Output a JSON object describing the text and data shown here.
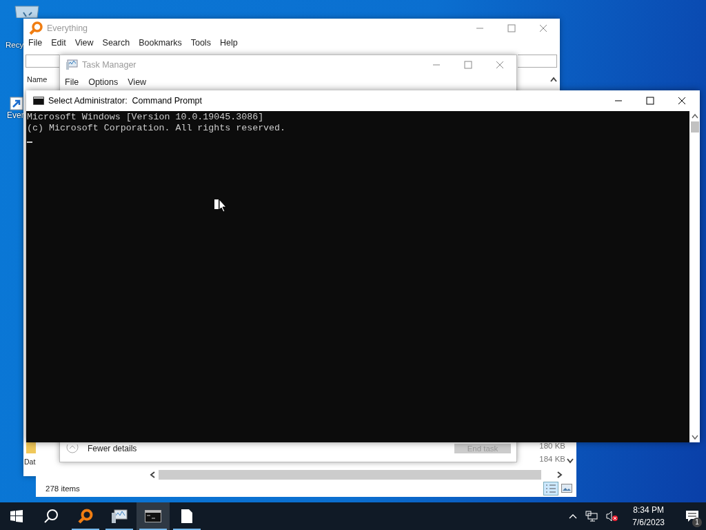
{
  "desktop_icons": [
    {
      "label": "Recy",
      "kind": "recycle"
    },
    {
      "label": "Ever",
      "kind": "shortcut"
    }
  ],
  "everything": {
    "title": "Everything",
    "menu": [
      "File",
      "Edit",
      "View",
      "Search",
      "Bookmarks",
      "Tools",
      "Help"
    ],
    "column": "Name",
    "rows": [
      {
        "name": "Dat",
        "kind": "folder"
      }
    ],
    "sizes": [
      "180 KB",
      "184 KB"
    ],
    "status": "278 items"
  },
  "task_manager": {
    "title": "Task Manager",
    "menu": [
      "File",
      "Options",
      "View"
    ],
    "fewer_details": "Fewer details",
    "end_task": {
      "label": "End task",
      "disabled": true
    }
  },
  "command_prompt": {
    "title": "Select Administrator:  Command Prompt",
    "lines": [
      "Microsoft Windows [Version 10.0.19045.3086]",
      "(c) Microsoft Corporation. All rights reserved."
    ]
  },
  "taskbar": {
    "apps": [
      {
        "kind": "everything",
        "selected": false
      },
      {
        "kind": "task-manager",
        "selected": false
      },
      {
        "kind": "cmd",
        "selected": true
      },
      {
        "kind": "file",
        "selected": false
      }
    ],
    "time": "8:34 PM",
    "date": "7/6/2023",
    "notifications": "1"
  }
}
